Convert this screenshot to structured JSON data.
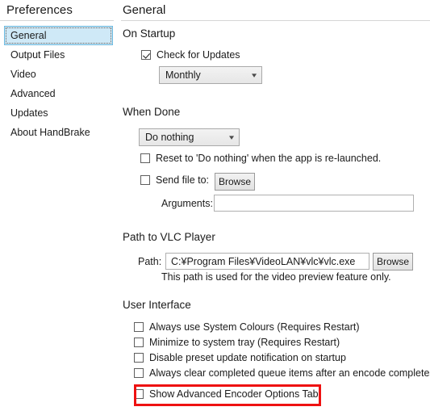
{
  "sidebar": {
    "title": "Preferences",
    "items": [
      {
        "label": "General",
        "selected": true
      },
      {
        "label": "Output Files",
        "selected": false
      },
      {
        "label": "Video",
        "selected": false
      },
      {
        "label": "Advanced",
        "selected": false
      },
      {
        "label": "Updates",
        "selected": false
      },
      {
        "label": "About HandBrake",
        "selected": false
      }
    ]
  },
  "panel": {
    "title": "General",
    "sections": {
      "on_startup": {
        "header": "On Startup",
        "check_for_updates": {
          "label": "Check for Updates",
          "checked": true
        },
        "frequency": {
          "value": "Monthly",
          "chevron": "chevron-down-icon"
        }
      },
      "when_done": {
        "header": "When Done",
        "action": {
          "value": "Do nothing",
          "chevron": "chevron-down-icon"
        },
        "reset_action": {
          "label": "Reset to 'Do nothing' when the app is re-launched.",
          "checked": false
        },
        "send_file_to": {
          "label": "Send file to:",
          "checked": false,
          "browse_label": "Browse"
        },
        "arguments": {
          "label": "Arguments:",
          "value": "",
          "placeholder": ""
        }
      },
      "vlc_path": {
        "header": "Path to VLC Player",
        "path_label": "Path:",
        "path_value": "C:¥Program Files¥VideoLAN¥vlc¥vlc.exe",
        "browse_label": "Browse",
        "hint": "This path is used for the video preview feature only."
      },
      "user_interface": {
        "header": "User Interface",
        "options": [
          {
            "label": "Always use System Colours (Requires Restart)",
            "checked": false,
            "highlighted": false
          },
          {
            "label": "Minimize to system tray (Requires Restart)",
            "checked": false,
            "highlighted": false
          },
          {
            "label": "Disable preset update notification on startup",
            "checked": false,
            "highlighted": false
          },
          {
            "label": "Always clear completed queue items after an encode completes",
            "checked": false,
            "highlighted": false
          },
          {
            "label": "Show Advanced Encoder Options Tab",
            "checked": false,
            "highlighted": true
          }
        ]
      }
    }
  },
  "colors": {
    "selection_fill": "#cfe9f7",
    "selection_border": "#6bb8de",
    "highlight": "#ee1111",
    "rule": "#d6d6d6"
  }
}
